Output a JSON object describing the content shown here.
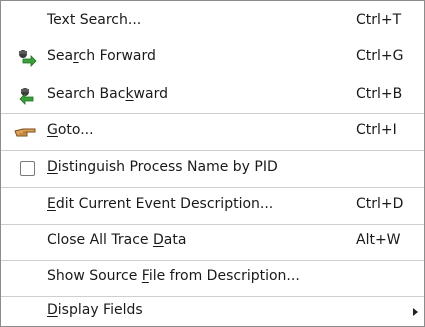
{
  "menu": {
    "items": [
      {
        "id": "text-search",
        "label": "Text Search...",
        "accel": "Ctrl+T",
        "icon": ""
      },
      {
        "id": "search-forward",
        "label_pre": "Sea",
        "label_u": "r",
        "label_post": "ch Forward",
        "accel": "Ctrl+G",
        "icon": "search-forward-icon"
      },
      {
        "id": "search-backward",
        "label_pre": "Search Bac",
        "label_u": "k",
        "label_post": "ward",
        "accel": "Ctrl+B",
        "icon": "search-backward-icon"
      },
      {
        "id": "goto",
        "label_pre": "",
        "label_u": "G",
        "label_post": "oto...",
        "accel": "Ctrl+I",
        "icon": "pointing-hand-icon"
      },
      {
        "id": "distinguish-process",
        "label_pre": "",
        "label_u": "D",
        "label_post": "istinguish Process Name by PID",
        "accel": "",
        "checked": false
      },
      {
        "id": "edit-event-description",
        "label_pre": "",
        "label_u": "E",
        "label_post": "dit Current Event Description...",
        "accel": "Ctrl+D"
      },
      {
        "id": "close-all-trace-data",
        "label_pre": "Close All Trace ",
        "label_u": "D",
        "label_post": "ata",
        "accel": "Alt+W"
      },
      {
        "id": "show-source-file",
        "label_pre": "Show Source ",
        "label_u": "F",
        "label_post": "ile from Description...",
        "accel": ""
      },
      {
        "id": "display-fields",
        "label_pre": "",
        "label_u": "D",
        "label_post": "isplay Fields",
        "accel": "",
        "submenu": true
      }
    ]
  },
  "colors": {
    "text": "#1a1a1a",
    "separator": "#cfcfcf",
    "border": "#8c8c8c",
    "icon_green": "#3aa03a",
    "icon_dark": "#3a3a3a"
  }
}
